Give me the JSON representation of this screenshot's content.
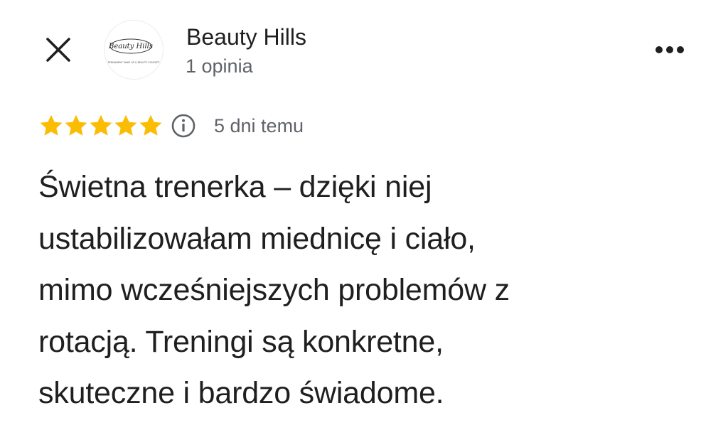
{
  "header": {
    "close_icon": "close-icon",
    "avatar_logo_text": "Beauty Hills",
    "avatar_logo_tagline": "PERMANENT MAKE UP & BEAUTY CONCEPT",
    "business_name": "Beauty Hills",
    "review_count": "1 opinia",
    "more_icon": "more-horizontal-icon"
  },
  "review": {
    "rating": 5,
    "rating_max": 5,
    "star_color": "#fbbc04",
    "info_icon": "info-icon",
    "date": "5 dni temu",
    "text_lines": [
      "Świetna trenerka – dzięki niej",
      "ustabilizowałam miednicę i ciało,",
      "mimo wcześniejszych problemów z",
      "rotacją. Treningi są konkretne,",
      "skuteczne i bardzo świadome."
    ]
  }
}
